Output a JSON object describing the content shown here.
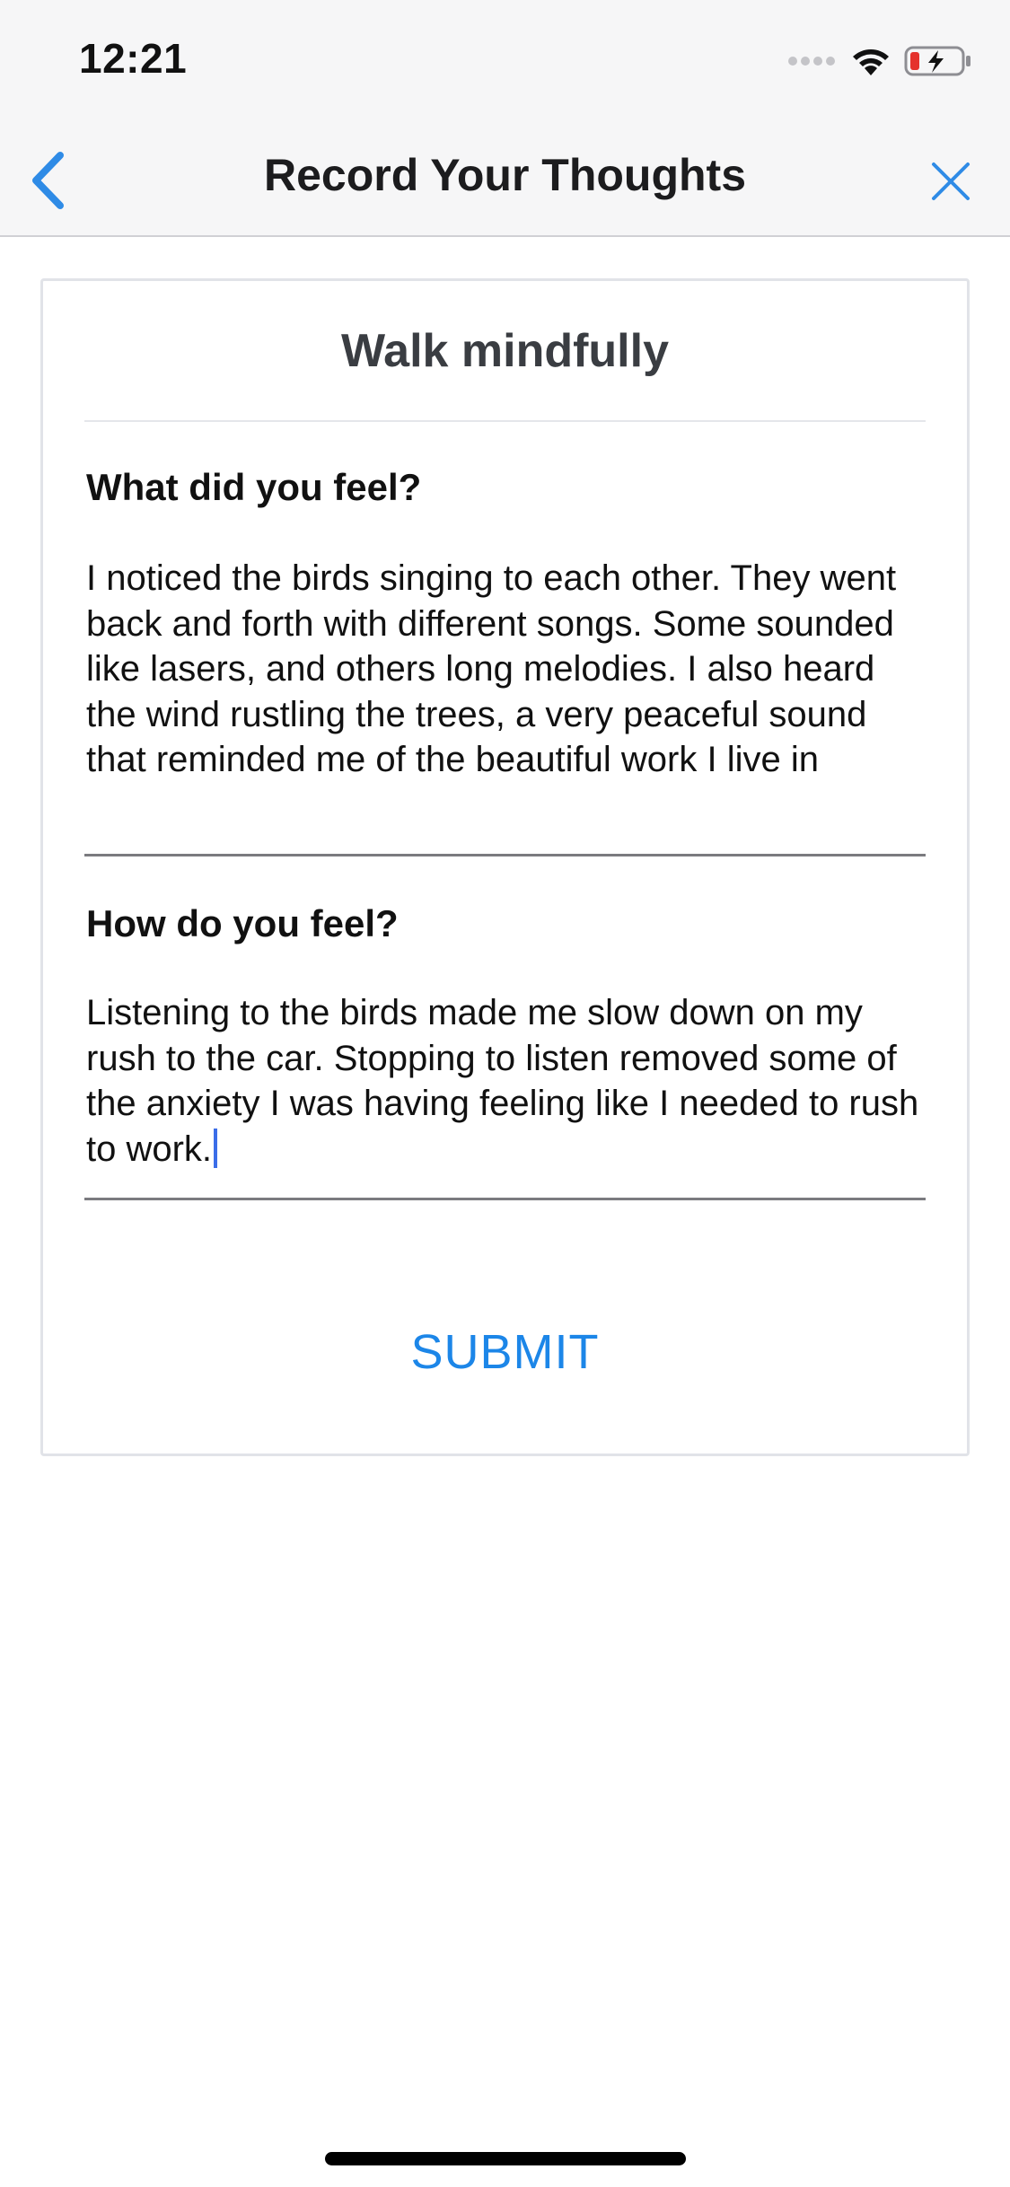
{
  "status_bar": {
    "time": "12:21",
    "icons": [
      "signal-dots-icon",
      "wifi-icon",
      "battery-charging-icon"
    ]
  },
  "nav": {
    "title": "Record Your Thoughts",
    "back_icon": "chevron-left-icon",
    "close_icon": "close-icon",
    "accent_color": "#2f8be6"
  },
  "card": {
    "title": "Walk mindfully",
    "questions": [
      {
        "label": "What did you feel?",
        "answer": "I noticed the birds singing to each other. They went back and forth with different songs. Some sounded like lasers, and others long melodies. I also heard the wind rustling the trees, a very peaceful sound that reminded me of the beautiful work I live in"
      },
      {
        "label": "How do you feel?",
        "answer": "Listening to the birds made me slow down on my rush to the car. Stopping to listen removed some of the anxiety I was having feeling like I needed to rush to work."
      }
    ],
    "submit_label": "SUBMIT",
    "submit_color": "#1c86e8"
  }
}
